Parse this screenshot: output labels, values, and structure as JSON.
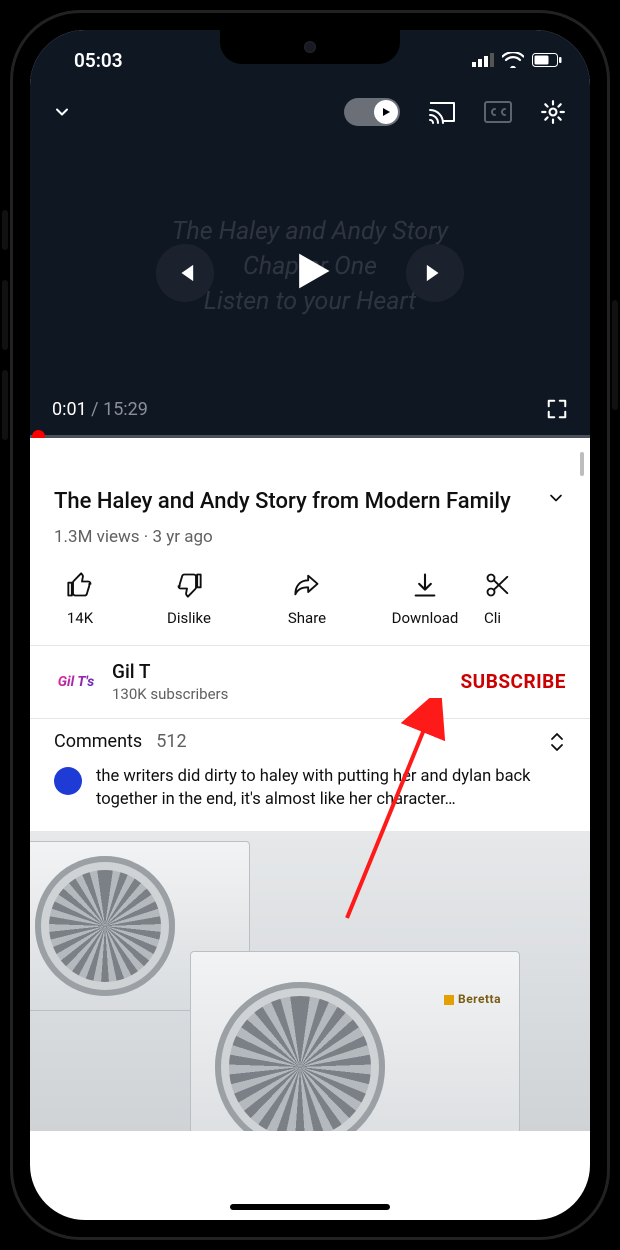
{
  "status": {
    "time": "05:03"
  },
  "player": {
    "overlay_line1": "The Haley and Andy Story",
    "overlay_line2": "Chapter One",
    "overlay_line3": "Listen to your Heart",
    "current_time": "0:01",
    "duration": "15:29",
    "time_separator": " / "
  },
  "video": {
    "title": "The Haley and Andy Story from Modern Family",
    "views": "1.3M views",
    "sep": " · ",
    "age": "3 yr ago"
  },
  "actions": {
    "like_count": "14K",
    "dislike": "Dislike",
    "share": "Share",
    "download": "Download",
    "clip": "Cli"
  },
  "channel": {
    "avatar_text": "Gil T's",
    "name": "Gil T",
    "subs": "130K subscribers",
    "subscribe_label": "SUBSCRIBE"
  },
  "comments": {
    "label": "Comments",
    "count": "512",
    "top_text": "the writers did dirty to haley with putting her and dylan back together in the end, it's almost like her character…"
  },
  "next_video": {
    "brand": "Beretta"
  }
}
